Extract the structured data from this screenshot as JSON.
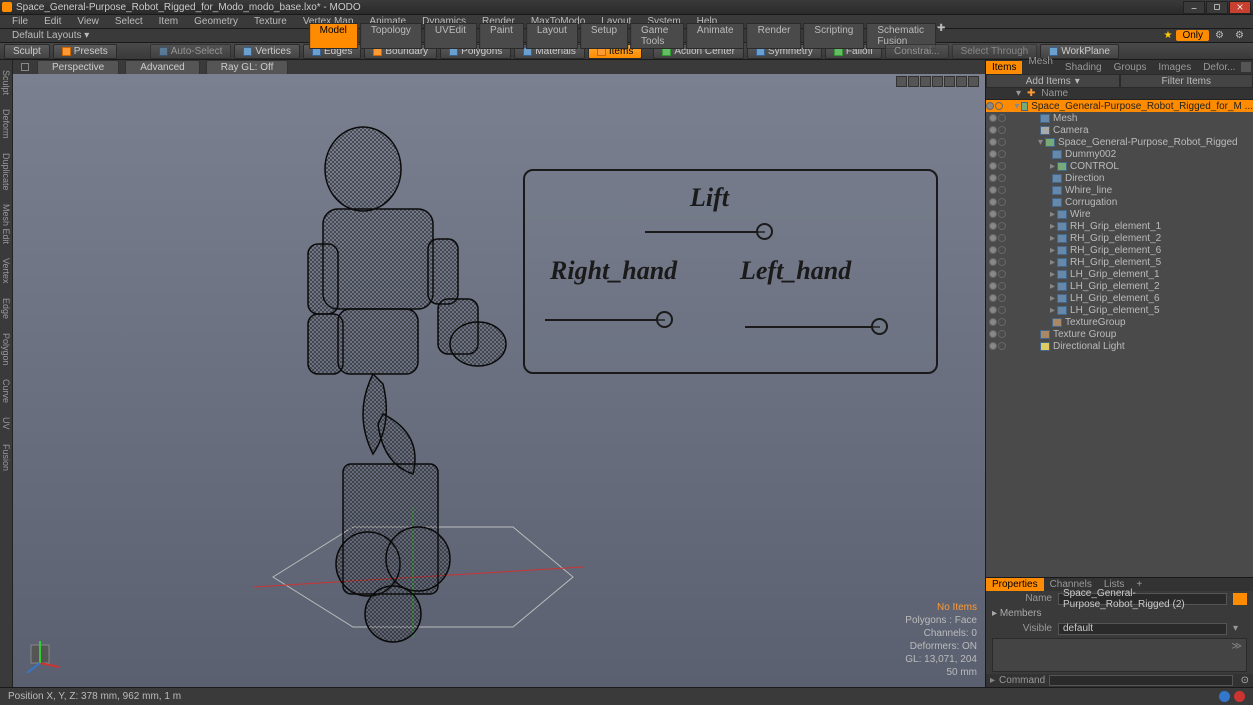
{
  "title": "Space_General-Purpose_Robot_Rigged_for_Modo_modo_base.lxo* - MODO",
  "menu": [
    "File",
    "Edit",
    "View",
    "Select",
    "Item",
    "Geometry",
    "Texture",
    "Vertex Map",
    "Animate",
    "Dynamics",
    "Render",
    "MaxToModo",
    "Layout",
    "System",
    "Help"
  ],
  "layout": {
    "default": "Default Layouts ▾",
    "tabs": [
      "Model",
      "Topology",
      "UVEdit",
      "Paint",
      "Layout",
      "Setup",
      "Game Tools",
      "Animate",
      "Render",
      "Scripting",
      "Schematic Fusion"
    ],
    "active": "Model",
    "only": "Only"
  },
  "toolbar": {
    "sculpt": "Sculpt",
    "presets": "Presets",
    "autoselect": "Auto-Select",
    "vertices": "Vertices",
    "edges": "Edges",
    "boundary": "Boundary",
    "polygons": "Polygons",
    "materials": "Materials",
    "items": "Items",
    "actioncenter": "Action Center",
    "symmetry": "Symmetry",
    "falloff": "Falloff",
    "constrain": "Constrai...",
    "select": "Select Through",
    "workplane": "WorkPlane"
  },
  "leftstrip": [
    "Sculpt",
    "Deform",
    "Duplicate",
    "Mesh Edit",
    "Vertex",
    "Edge",
    "Polygon",
    "Curve",
    "UV",
    "Fusion"
  ],
  "viewtabs": {
    "perspective": "Perspective",
    "advanced": "Advanced",
    "ray": "Ray GL: Off"
  },
  "controls": {
    "lift": "Lift",
    "rhand": "Right_hand",
    "lhand": "Left_hand"
  },
  "vpinfo": {
    "noitems": "No Items",
    "polygons": "Polygons : Face",
    "channels": "Channels: 0",
    "deformers": "Deformers: ON",
    "gl": "GL: 13,071, 204",
    "scale": "50 mm"
  },
  "right": {
    "tabs": [
      "Items",
      "Mesh ...",
      "Shading",
      "Groups",
      "Images",
      "Defor..."
    ],
    "active": "Items",
    "add": "Add Items",
    "filter": "Filter Items",
    "namecol": "Name"
  },
  "tree": [
    {
      "d": 0,
      "e": "▾",
      "i": "grp",
      "n": "Space_General-Purpose_Robot_Rigged_for_M ...",
      "sel": true
    },
    {
      "d": 1,
      "e": "",
      "i": "msh",
      "n": "Mesh"
    },
    {
      "d": 1,
      "e": "",
      "i": "cam",
      "n": "Camera"
    },
    {
      "d": 1,
      "e": "▾",
      "i": "grp",
      "n": "Space_General-Purpose_Robot_Rigged"
    },
    {
      "d": 2,
      "e": "",
      "i": "msh",
      "n": "Dummy002"
    },
    {
      "d": 2,
      "e": "▸",
      "i": "grp",
      "n": "CONTROL"
    },
    {
      "d": 2,
      "e": "",
      "i": "msh",
      "n": "Direction"
    },
    {
      "d": 2,
      "e": "",
      "i": "msh",
      "n": "Whire_line"
    },
    {
      "d": 2,
      "e": "",
      "i": "msh",
      "n": "Corrugation"
    },
    {
      "d": 2,
      "e": "▸",
      "i": "msh",
      "n": "Wire"
    },
    {
      "d": 2,
      "e": "▸",
      "i": "msh",
      "n": "RH_Grip_element_1"
    },
    {
      "d": 2,
      "e": "▸",
      "i": "msh",
      "n": "RH_Grip_element_2"
    },
    {
      "d": 2,
      "e": "▸",
      "i": "msh",
      "n": "RH_Grip_element_6"
    },
    {
      "d": 2,
      "e": "▸",
      "i": "msh",
      "n": "RH_Grip_element_5"
    },
    {
      "d": 2,
      "e": "▸",
      "i": "msh",
      "n": "LH_Grip_element_1"
    },
    {
      "d": 2,
      "e": "▸",
      "i": "msh",
      "n": "LH_Grip_element_2"
    },
    {
      "d": 2,
      "e": "▸",
      "i": "msh",
      "n": "LH_Grip_element_6"
    },
    {
      "d": 2,
      "e": "▸",
      "i": "msh",
      "n": "LH_Grip_element_5"
    },
    {
      "d": 2,
      "e": "",
      "i": "tex",
      "n": "TextureGroup"
    },
    {
      "d": 1,
      "e": "",
      "i": "tex",
      "n": "Texture Group"
    },
    {
      "d": 1,
      "e": "",
      "i": "lit",
      "n": "Directional Light"
    }
  ],
  "props": {
    "tabs": [
      "Properties",
      "Channels",
      "Lists",
      "+"
    ],
    "active": "Properties",
    "name_lbl": "Name",
    "name_val": "Space_General-Purpose_Robot_Rigged (2)",
    "members": "Members",
    "visible_lbl": "Visible",
    "visible_val": "default",
    "command": "Command"
  },
  "status": {
    "pos": "Position X, Y, Z:   378 mm, 962 mm, 1 m"
  }
}
